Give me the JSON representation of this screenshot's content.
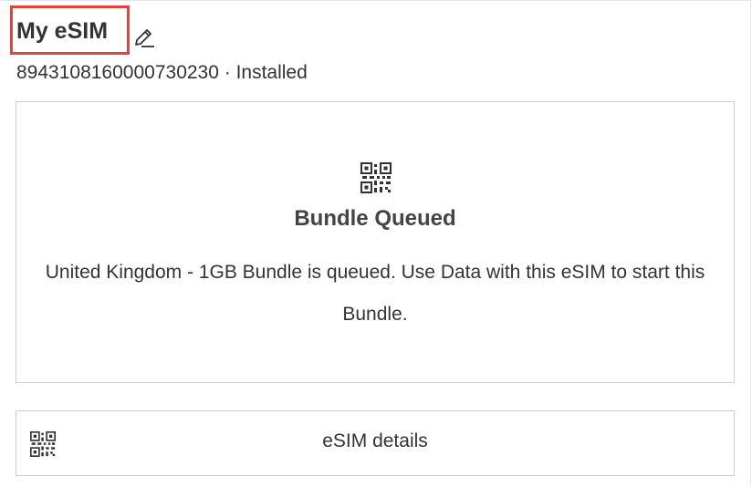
{
  "header": {
    "title": "My eSIM",
    "edit_icon": "pencil-edit-icon",
    "subtitle": "8943108160000730230 · Installed"
  },
  "status_card": {
    "icon": "qr-code-icon",
    "title": "Bundle Queued",
    "description": "United Kingdom - 1GB Bundle is queued. Use Data with this eSIM to start this Bundle."
  },
  "details_button": {
    "icon": "qr-code-icon",
    "label": "eSIM details"
  },
  "colors": {
    "highlight_border": "#e0453a",
    "text": "#333333",
    "card_border": "#cfcfcf"
  }
}
